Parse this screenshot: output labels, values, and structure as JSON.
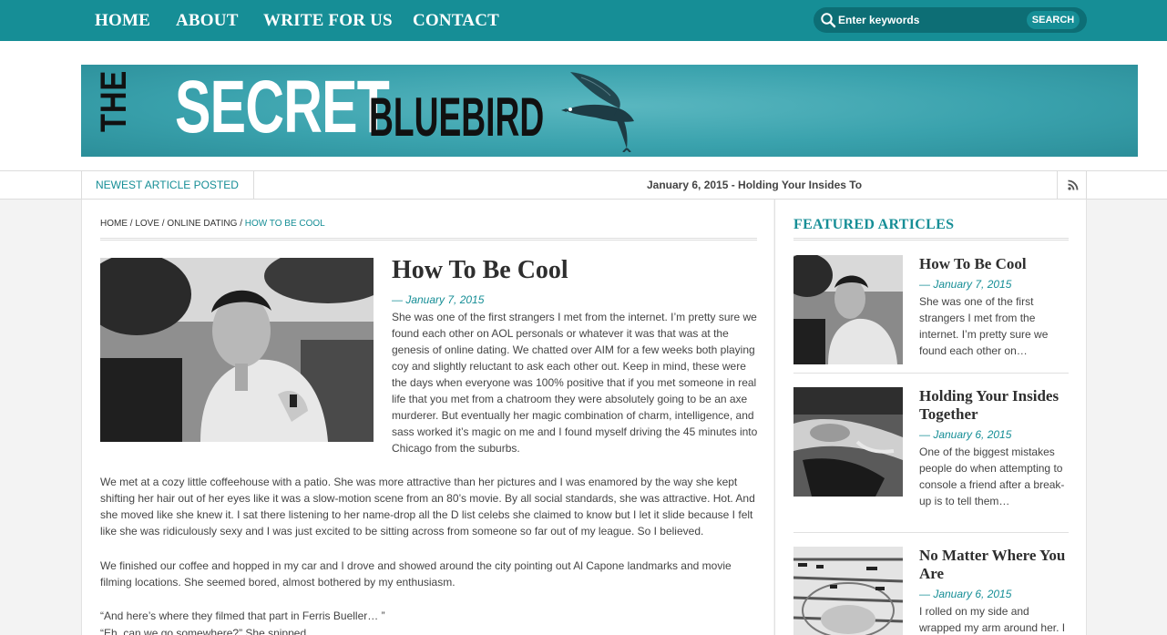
{
  "nav": {
    "items": [
      "HOME",
      "ABOUT",
      "WRITE FOR US",
      "CONTACT"
    ],
    "search_placeholder": "Enter keywords",
    "search_button": "SEARCH"
  },
  "banner": {
    "the": "THE",
    "secret": "SECRET",
    "bluebird": "BLUEBIRD"
  },
  "ticker": {
    "label": "NEWEST ARTICLE POSTED",
    "text": "January 6, 2015 - Holding Your Insides To"
  },
  "breadcrumb": {
    "items": [
      "HOME",
      "LOVE",
      "ONLINE DATING"
    ],
    "current": "HOW TO BE COOL"
  },
  "article": {
    "title": "How To Be Cool",
    "date": "— January 7, 2015",
    "intro": "She was one of the first strangers I met from the internet. I’m pretty sure we found each other on AOL personals or whatever it was that was at the genesis of online dating. We chatted over AIM for a few weeks both playing coy and slightly reluctant to ask each other out. Keep in mind, these were the days when everyone was 100% positive that if you met someone in real life that you met from a chatroom they were absolutely going to be an axe murderer. But eventually her magic combination of charm, intelligence, and sass worked it’s magic on me and I found myself driving the 45 minutes into Chicago from the suburbs.",
    "p1": "We met at a cozy little coffeehouse with a patio. She was more attractive than her pictures and I was enamored by the way she kept shifting her hair out of her eyes like it was a slow-motion scene from an 80’s movie. By all social standards, she was attractive. Hot. And she moved like she knew it. I sat there listening to her name-drop all the D list celebs she claimed to know but I let it slide because I felt like she was ridiculously sexy and I was just excited to be sitting across from someone so far out of my league. So I believed.",
    "p2": "We finished our coffee and hopped in my car and I drove and showed around the city pointing out Al Capone landmarks and movie filming locations. She seemed bored, almost bothered by my enthusiasm.",
    "p3": "“And here’s where they filmed that part in Ferris Bueller… ”",
    "p4": "“Eh, can we go somewhere?” She snipped."
  },
  "featured": {
    "heading": "FEATURED ARTICLES",
    "items": [
      {
        "title": "How To Be Cool",
        "date": "— January 7, 2015",
        "excerpt": "She was one of the first strangers I met from the internet. I’m pretty sure we found each other on…"
      },
      {
        "title": "Holding Your Insides Together",
        "date": "— January 6, 2015",
        "excerpt": "One of the biggest mistakes people do when attempting to console a friend after a break-up is to tell them…"
      },
      {
        "title": "No Matter Where You Are",
        "date": "— January 6, 2015",
        "excerpt": "I rolled on my side and wrapped my arm around her. I"
      }
    ]
  },
  "colors": {
    "accent": "#168e96",
    "banner": "#3aa2ad"
  }
}
